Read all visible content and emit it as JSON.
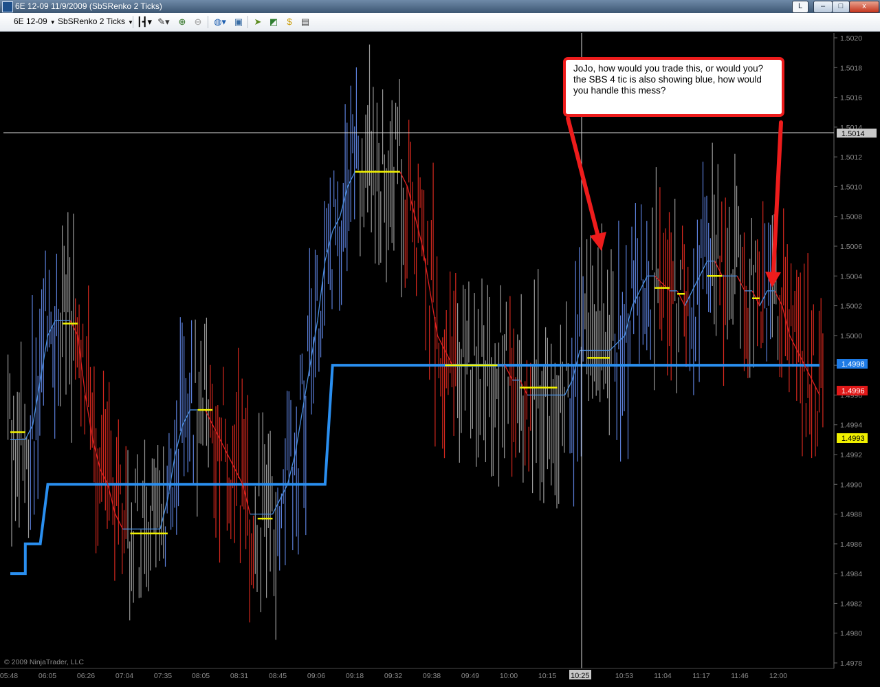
{
  "window": {
    "title": "6E 12-09  11/9/2009 (SbSRenko 2 Ticks)",
    "link_button": "L",
    "controls": {
      "minimize": "–",
      "restore": "□",
      "close": "x"
    }
  },
  "toolbar": {
    "instrument": "6E 12-09",
    "period": "SbSRenko 2 Ticks",
    "icons": [
      "bar-type-icon",
      "drawing-tool-icon",
      "zoom-in-icon",
      "zoom-out-icon",
      "globe-icon",
      "properties-icon",
      "strategy-icon",
      "indicators-icon",
      "dollar-icon",
      "data-box-icon"
    ]
  },
  "chart": {
    "annotation": "JoJo, how would you trade this, or would you? the SBS 4 tic is also showing blue, how would you handle this mess?",
    "copyright": "© 2009 NinjaTrader, LLC",
    "crosshair_time": "10:25",
    "crosshair_price": "1.5014",
    "price_markers": [
      {
        "value": "1.4998",
        "bg": "#1e7be6",
        "fg": "#ffffff"
      },
      {
        "value": "1.4996",
        "bg": "#e01818",
        "fg": "#ffffff"
      },
      {
        "value": "1.4993",
        "bg": "#f0f000",
        "fg": "#000000"
      }
    ],
    "colors": {
      "up": "#5b7fd9",
      "down": "#d5281e",
      "neutral": "#9a9a9a",
      "ma_up": "#4a8fe0",
      "ma_down": "#e02020",
      "level": "#f2f200",
      "trail": "#2a8ff0",
      "callout": "#ee1c1c"
    }
  },
  "chart_data": {
    "type": "line",
    "title": "",
    "xlabel": "",
    "ylabel": "",
    "ylim": [
      1.4978,
      1.502
    ],
    "y_ticks": [
      "1.5020",
      "1.5018",
      "1.5016",
      "1.5014",
      "1.5012",
      "1.5010",
      "1.5008",
      "1.5006",
      "1.5004",
      "1.5002",
      "1.5000",
      "1.4998",
      "1.4996",
      "1.4994",
      "1.4992",
      "1.4990",
      "1.4988",
      "1.4986",
      "1.4984",
      "1.4982",
      "1.4980",
      "1.4978"
    ],
    "x_ticks": [
      "05:48",
      "06:05",
      "06:26",
      "07:04",
      "07:35",
      "08:05",
      "08:31",
      "08:45",
      "09:06",
      "09:18",
      "09:32",
      "09:38",
      "09:49",
      "10:00",
      "10:15",
      "10:25",
      "10:53",
      "11:04",
      "11:17",
      "11:46",
      "12:00"
    ],
    "series": [
      {
        "key": "trail",
        "values": [
          [
            0,
            1.4984
          ],
          [
            2,
            1.4984
          ],
          [
            2,
            1.4986
          ],
          [
            4,
            1.4986
          ],
          [
            5,
            1.499
          ],
          [
            42,
            1.499
          ],
          [
            43,
            1.4998
          ],
          [
            108,
            1.4998
          ]
        ]
      },
      {
        "key": "fast",
        "values": [
          [
            0,
            1.4993
          ],
          [
            2,
            1.4993
          ],
          [
            3,
            1.4994
          ],
          [
            4,
            1.4997
          ],
          [
            5,
            1.5
          ],
          [
            6,
            1.5001
          ],
          [
            7,
            1.5001
          ],
          [
            8,
            1.5001
          ],
          [
            9,
            1.5
          ],
          [
            10,
            1.4996
          ],
          [
            11,
            1.4993
          ],
          [
            12,
            1.4991
          ],
          [
            13,
            1.499
          ],
          [
            14,
            1.4988
          ],
          [
            15,
            1.4987
          ],
          [
            17,
            1.4987
          ],
          [
            19,
            1.4987
          ],
          [
            20,
            1.4987
          ],
          [
            21,
            1.4989
          ],
          [
            22,
            1.4992
          ],
          [
            23,
            1.4994
          ],
          [
            24,
            1.4995
          ],
          [
            26,
            1.4995
          ],
          [
            27,
            1.4994
          ],
          [
            28,
            1.4993
          ],
          [
            29,
            1.4992
          ],
          [
            30,
            1.4991
          ],
          [
            31,
            1.499
          ],
          [
            32,
            1.4988
          ],
          [
            33,
            1.4988
          ],
          [
            34,
            1.4988
          ],
          [
            35,
            1.4988
          ],
          [
            36,
            1.4989
          ],
          [
            37,
            1.499
          ],
          [
            38,
            1.4992
          ],
          [
            39,
            1.4995
          ],
          [
            40,
            1.4998
          ],
          [
            41,
            1.5001
          ],
          [
            42,
            1.5005
          ],
          [
            43,
            1.5007
          ],
          [
            44,
            1.5008
          ],
          [
            45,
            1.501
          ],
          [
            46,
            1.5011
          ],
          [
            48,
            1.5011
          ],
          [
            52,
            1.5011
          ],
          [
            53,
            1.501
          ],
          [
            54,
            1.5008
          ],
          [
            55,
            1.5006
          ],
          [
            56,
            1.5003
          ],
          [
            57,
            1.5
          ],
          [
            58,
            1.4999
          ],
          [
            59,
            1.4998
          ],
          [
            60,
            1.4998
          ],
          [
            62,
            1.4998
          ],
          [
            64,
            1.4998
          ],
          [
            66,
            1.4998
          ],
          [
            67,
            1.4997
          ],
          [
            68,
            1.4997
          ],
          [
            69,
            1.4996
          ],
          [
            70,
            1.4996
          ],
          [
            72,
            1.4996
          ],
          [
            74,
            1.4996
          ],
          [
            75,
            1.4997
          ],
          [
            76,
            1.4999
          ],
          [
            77,
            1.4999
          ],
          [
            78,
            1.4999
          ],
          [
            80,
            1.4999
          ],
          [
            82,
            1.5
          ],
          [
            83,
            1.5002
          ],
          [
            84,
            1.5003
          ],
          [
            85,
            1.5004
          ],
          [
            86,
            1.5004
          ],
          [
            88,
            1.5003
          ],
          [
            89,
            1.5003
          ],
          [
            90,
            1.5002
          ],
          [
            91,
            1.5003
          ],
          [
            92,
            1.5004
          ],
          [
            93,
            1.5005
          ],
          [
            94,
            1.5005
          ],
          [
            95,
            1.5004
          ],
          [
            96,
            1.5004
          ],
          [
            97,
            1.5004
          ],
          [
            98,
            1.5003
          ],
          [
            99,
            1.5003
          ],
          [
            100,
            1.5002
          ],
          [
            101,
            1.5003
          ],
          [
            102,
            1.5003
          ],
          [
            103,
            1.5002
          ],
          [
            104,
            1.5
          ],
          [
            105,
            1.4999
          ],
          [
            106,
            1.4998
          ],
          [
            107,
            1.4997
          ],
          [
            108,
            1.4996
          ]
        ]
      },
      {
        "key": "levels",
        "values": [
          [
            0,
            2,
            1.49935
          ],
          [
            7,
            9,
            1.50008
          ],
          [
            16,
            21,
            1.49867
          ],
          [
            25,
            27,
            1.4995
          ],
          [
            33,
            35,
            1.49877
          ],
          [
            46,
            52,
            1.5011
          ],
          [
            58,
            65,
            1.4998
          ],
          [
            68,
            73,
            1.49965
          ],
          [
            77,
            80,
            1.49985
          ],
          [
            86,
            88,
            1.50032
          ],
          [
            89,
            90,
            1.50028
          ],
          [
            93,
            95,
            1.5004
          ],
          [
            99,
            100,
            1.50025
          ]
        ]
      }
    ],
    "bars_seed": 4521
  }
}
